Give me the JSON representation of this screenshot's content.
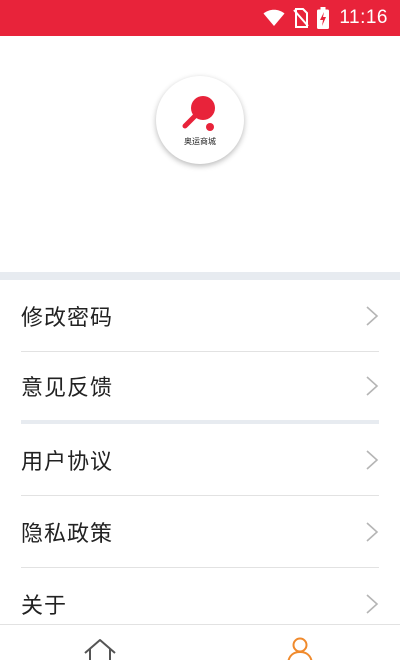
{
  "status_bar": {
    "time": "11:16",
    "icons": [
      "wifi-icon",
      "no-sim-icon",
      "battery-charging-icon"
    ],
    "background": "#e8233a"
  },
  "profile": {
    "logo_caption": "奥运商城"
  },
  "menu": {
    "items": [
      {
        "label": "修改密码"
      },
      {
        "label": "意见反馈"
      },
      {
        "label": "用户协议"
      },
      {
        "label": "隐私政策"
      },
      {
        "label": "关于"
      }
    ]
  },
  "bottom_nav": {
    "tabs": [
      {
        "icon": "home-icon",
        "active": false
      },
      {
        "icon": "user-icon",
        "active": true
      }
    ],
    "active_color": "#f08a2c"
  }
}
